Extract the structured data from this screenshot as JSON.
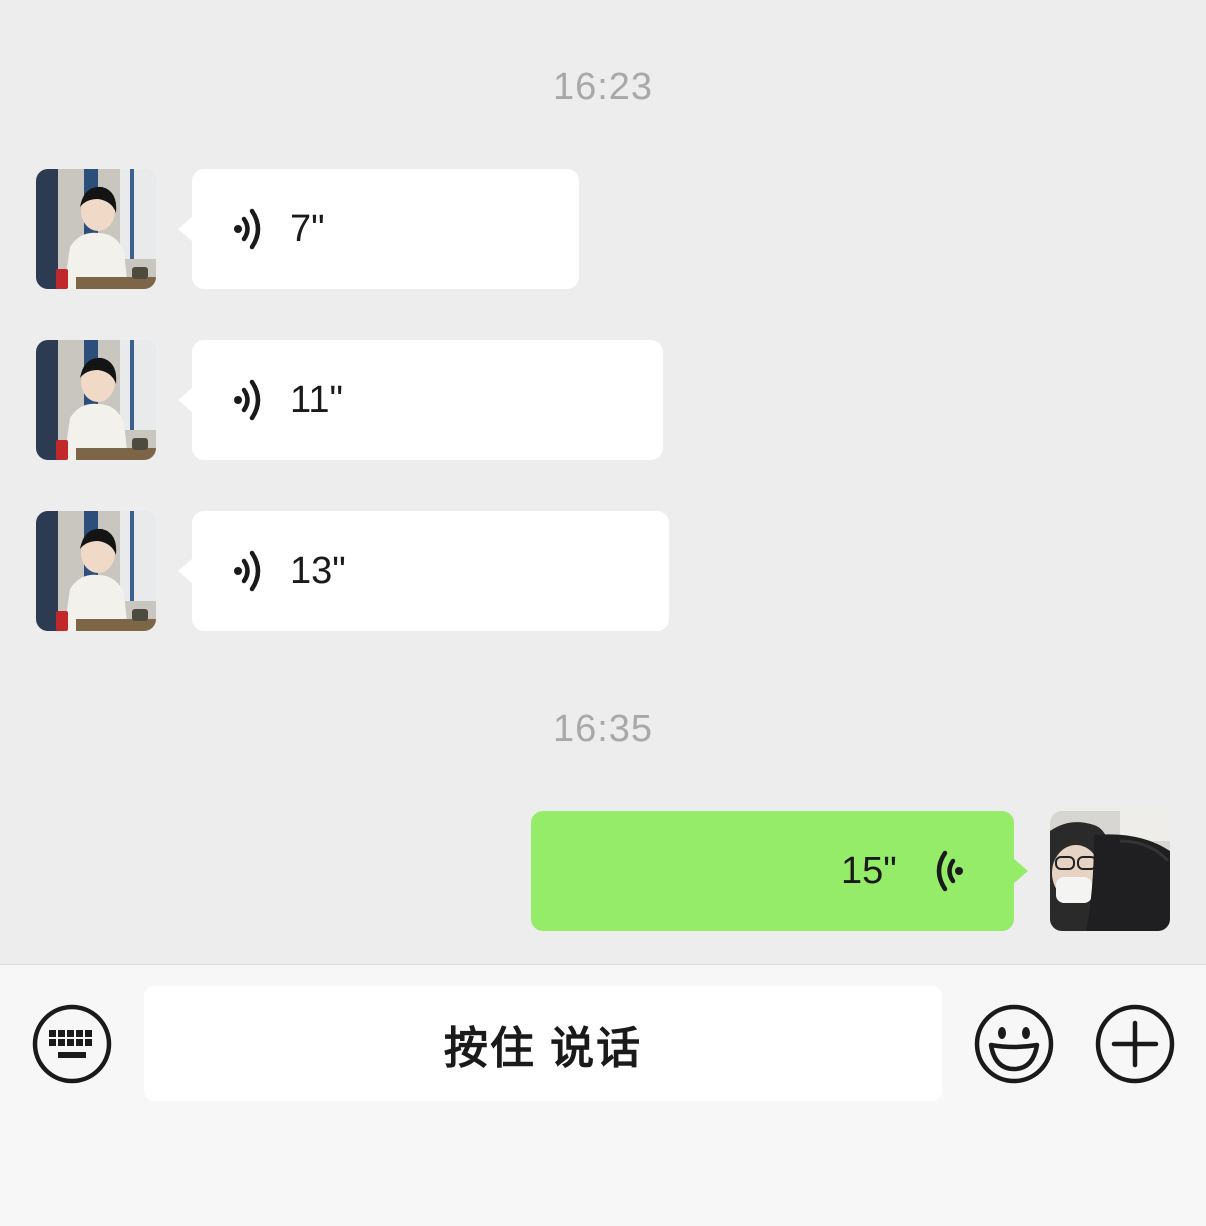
{
  "chat": {
    "timestamps": [
      "16:23",
      "16:35"
    ],
    "messages": [
      {
        "direction": "incoming",
        "type": "voice",
        "duration": "7\""
      },
      {
        "direction": "incoming",
        "type": "voice",
        "duration": "11\""
      },
      {
        "direction": "incoming",
        "type": "voice",
        "duration": "13\""
      },
      {
        "direction": "outgoing",
        "type": "voice",
        "duration": "15\""
      }
    ]
  },
  "input_bar": {
    "hold_to_talk_label": "按住 说话",
    "icons": {
      "left": "keyboard-icon",
      "emoji": "smiley-icon",
      "more": "plus-icon"
    }
  },
  "colors": {
    "chat_background": "#ededed",
    "incoming_bubble": "#ffffff",
    "outgoing_bubble": "#95ec69",
    "timestamp_text": "#a8a8a8",
    "toolbar_background": "#f7f7f7"
  }
}
